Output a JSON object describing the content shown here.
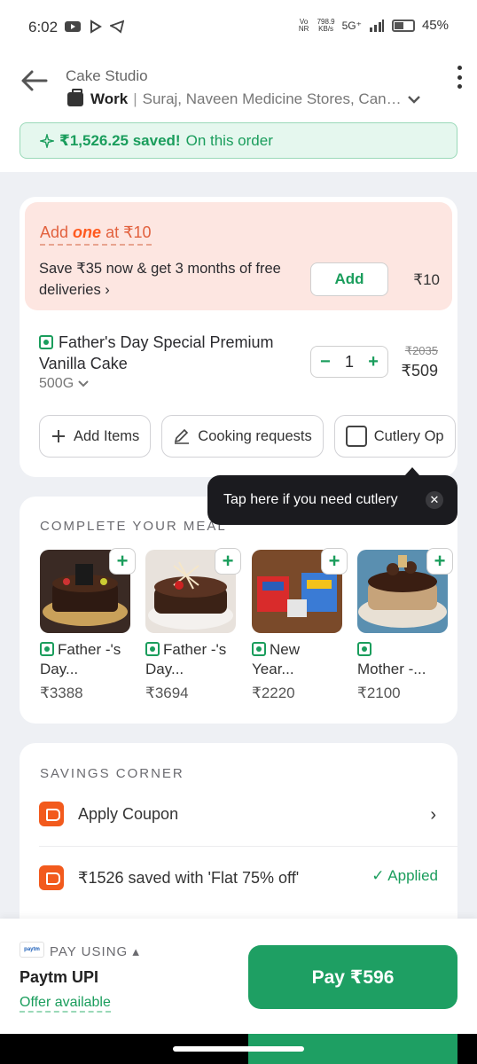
{
  "status_bar": {
    "time": "6:02",
    "net_speed_value": "798.9",
    "net_speed_unit": "KB/s",
    "network": "5G⁺",
    "battery": "45%",
    "battery_level": 0.45,
    "volte": "Vo NR"
  },
  "header": {
    "restaurant": "Cake Studio",
    "address_label": "Work",
    "address": "Suraj, Naveen Medicine Stores, Cantt..."
  },
  "savings_banner": {
    "amount": "₹1,526.25 saved!",
    "suffix": "On this order"
  },
  "one_offer": {
    "prefix": "Add",
    "brand": "one",
    "suffix": "at ₹10",
    "description": "Save ₹35 now & get 3 months of free deliveries",
    "add_label": "Add",
    "price": "₹10"
  },
  "cart_item": {
    "name": "Father's Day Special Premium Vanilla Cake",
    "size": "500G",
    "quantity": "1",
    "original_price": "₹2035",
    "price": "₹509"
  },
  "chips": {
    "add_items": "Add Items",
    "cooking_requests": "Cooking requests",
    "cutlery": "Cutlery Op"
  },
  "tooltip": {
    "text": "Tap here if you need cutlery"
  },
  "complete_meal": {
    "title": "COMPLETE YOUR MEAL",
    "items": [
      {
        "name": "Father -'s Day...",
        "price": "₹3388"
      },
      {
        "name": "Father -'s Day...",
        "price": "₹3694"
      },
      {
        "name": "New Year...",
        "price": "₹2220"
      },
      {
        "name": "Mother -...",
        "price": "₹2100"
      }
    ]
  },
  "savings_corner": {
    "title": "SAVINGS CORNER",
    "apply_coupon": "Apply Coupon",
    "applied_text": "₹1526 saved with 'Flat 75% off'",
    "applied_label": "✓ Applied"
  },
  "payment": {
    "logo_text": "paytm",
    "pay_using": "PAY USING",
    "method": "Paytm UPI",
    "offer": "Offer available",
    "pay_button": "Pay ₹596"
  },
  "colors": {
    "accent_green": "#1e9f63",
    "one_orange": "#ff5a1f",
    "banner_bg": "#e5f7ee",
    "one_bg": "#fde6e1"
  }
}
